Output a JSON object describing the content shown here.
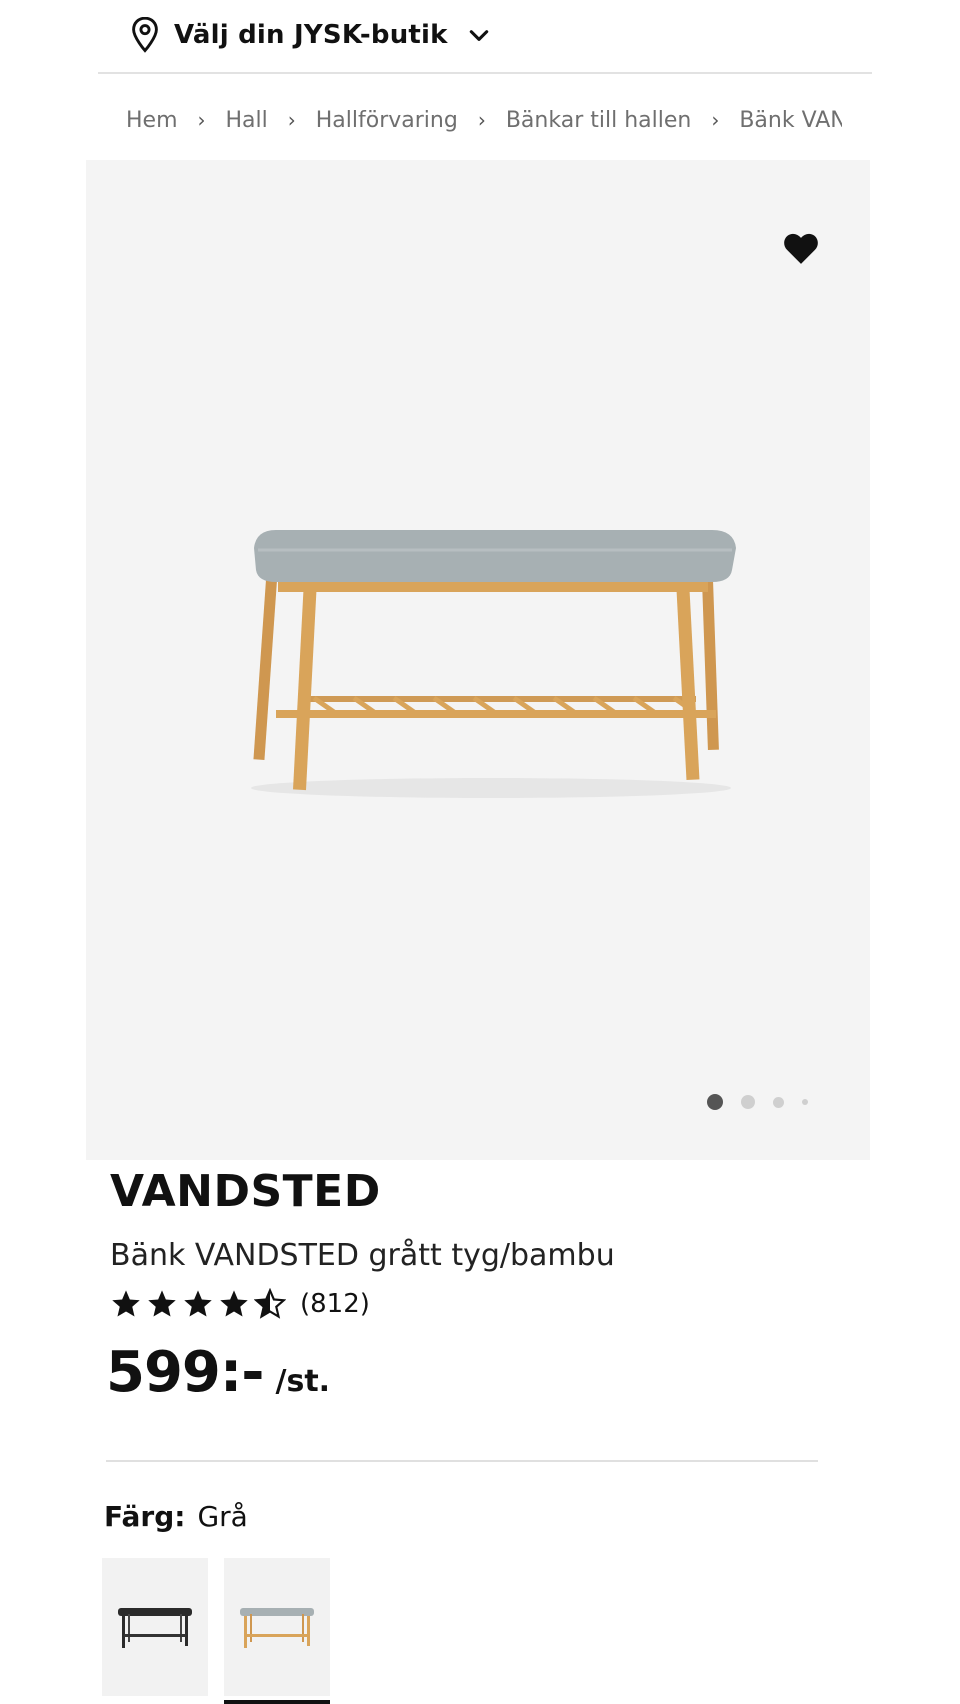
{
  "store": {
    "label": "Välj din JYSK-butik"
  },
  "breadcrumb": [
    "Hem",
    "Hall",
    "Hallförvaring",
    "Bänkar till hallen",
    "Bänk VANDSTED"
  ],
  "product": {
    "brand": "VANDSTED",
    "name": "Bänk VANDSTED grått tyg/bambu",
    "rating": 4.5,
    "rating_max": 5,
    "review_count": "(812)",
    "price": "599:-",
    "price_unit": "/st."
  },
  "gallery": {
    "images_total": 4,
    "current_index": 1
  },
  "color": {
    "label": "Färg:",
    "value": "Grå"
  },
  "swatches": [
    {
      "name": "black-bench-swatch",
      "selected": false
    },
    {
      "name": "grey-bench-swatch",
      "selected": true
    }
  ],
  "colors": {
    "star": "#111111",
    "gallery_bg": "#f4f4f4",
    "wood": "#d9a45a",
    "cushion": "#a7b0b3"
  }
}
